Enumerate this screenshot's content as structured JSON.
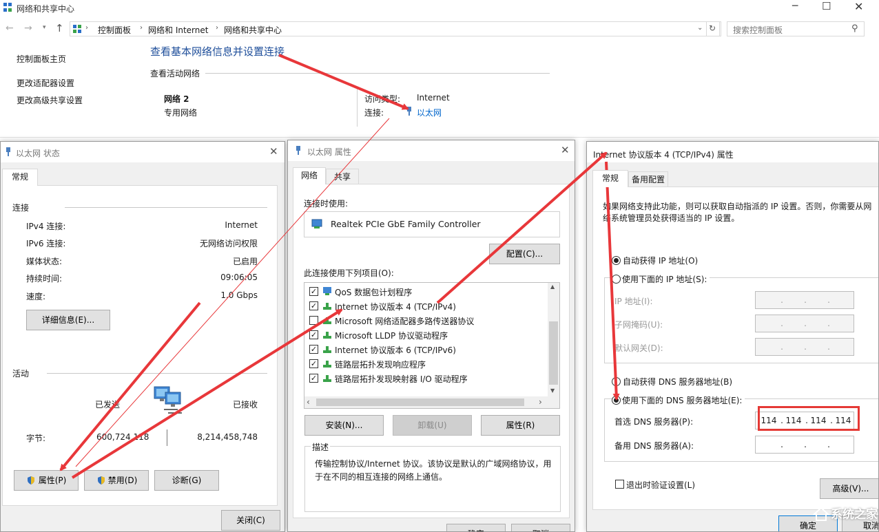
{
  "main_window": {
    "title": "网络和共享中心",
    "breadcrumb": [
      "控制面板",
      "网络和 Internet",
      "网络和共享中心"
    ],
    "search_placeholder": "搜索控制面板",
    "sidebar": [
      "控制面板主页",
      "更改适配器设置",
      "更改高级共享设置"
    ],
    "heading": "查看基本网络信息并设置连接",
    "active_networks_label": "查看活动网络",
    "network_name": "网络 2",
    "network_type": "专用网络",
    "access_type_label": "访问类型:",
    "access_type_value": "Internet",
    "connection_label": "连接:",
    "connection_value": "以太网"
  },
  "status_dialog": {
    "title": "以太网 状态",
    "tab": "常规",
    "section_connection": "连接",
    "rows": [
      {
        "label": "IPv4 连接:",
        "value": "Internet"
      },
      {
        "label": "IPv6 连接:",
        "value": "无网络访问权限"
      },
      {
        "label": "媒体状态:",
        "value": "已启用"
      },
      {
        "label": "持续时间:",
        "value": "09:06:05"
      },
      {
        "label": "速度:",
        "value": "1.0 Gbps"
      }
    ],
    "details_button": "详细信息(E)...",
    "section_activity": "活动",
    "sent_label": "已发送",
    "received_label": "已接收",
    "bytes_label": "字节:",
    "bytes_sent": "600,724,118",
    "bytes_received": "8,214,458,748",
    "properties_button": "属性(P)",
    "disable_button": "禁用(D)",
    "diagnose_button": "诊断(G)",
    "close_button": "关闭(C)"
  },
  "props_dialog": {
    "title": "以太网 属性",
    "tabs": [
      "网络",
      "共享"
    ],
    "connect_using_label": "连接时使用:",
    "adapter": "Realtek PCIe GbE Family Controller",
    "configure_button": "配置(C)...",
    "items_label": "此连接使用下列项目(O):",
    "items": [
      {
        "label": "QoS 数据包计划程序",
        "checked": true
      },
      {
        "label": "Internet 协议版本 4 (TCP/IPv4)",
        "checked": true
      },
      {
        "label": "Microsoft 网络适配器多路传送器协议",
        "checked": false
      },
      {
        "label": "Microsoft LLDP 协议驱动程序",
        "checked": true
      },
      {
        "label": "Internet 协议版本 6 (TCP/IPv6)",
        "checked": true
      },
      {
        "label": "链路层拓扑发现响应程序",
        "checked": true
      },
      {
        "label": "链路层拓扑发现映射器 I/O 驱动程序",
        "checked": true
      }
    ],
    "install_button": "安装(N)...",
    "uninstall_button": "卸载(U)",
    "properties_button": "属性(R)",
    "description_label": "描述",
    "description_line1": "传输控制协议/Internet 协议。该协议是默认的广域网络协议，用",
    "description_line2": "于在不同的相互连接的网络上通信。",
    "ok_button": "确定",
    "cancel_button": "取消"
  },
  "ipv4_dialog": {
    "title": "Internet 协议版本 4 (TCP/IPv4) 属性",
    "tabs": [
      "常规",
      "备用配置"
    ],
    "intro_line1": "如果网络支持此功能，则可以获取自动指派的 IP 设置。否则，你需要从网",
    "intro_line2": "络系统管理员处获得适当的 IP 设置。",
    "auto_ip": "自动获得 IP 地址(O)",
    "manual_ip": "使用下面的 IP 地址(S):",
    "ip_label": "IP 地址(I):",
    "subnet_label": "子网掩码(U):",
    "gateway_label": "默认网关(D):",
    "auto_dns": "自动获得 DNS 服务器地址(B)",
    "manual_dns": "使用下面的 DNS 服务器地址(E):",
    "preferred_dns_label": "首选 DNS 服务器(P):",
    "preferred_dns": [
      "114",
      "114",
      "114",
      "114"
    ],
    "alternate_dns_label": "备用 DNS 服务器(A):",
    "validate_label": "退出时验证设置(L)",
    "advanced_button": "高级(V)...",
    "ok_button": "确定",
    "cancel_button": "取消"
  },
  "watermark": "系统之家",
  "colors": {
    "arrow": "#e8373a",
    "link": "#0066cc",
    "highlight_box": "#e53935"
  }
}
